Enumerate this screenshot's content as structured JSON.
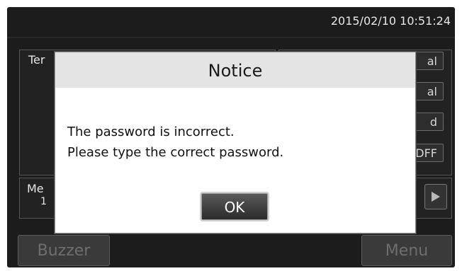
{
  "header": {
    "datetime": "2015/02/10  10:51:24"
  },
  "background": {
    "left_panel_label": "Ter",
    "right_buttons": [
      "al",
      "al",
      "d",
      "DFF"
    ],
    "mid_panel_label_1": "Me",
    "mid_panel_label_2": "1"
  },
  "footer": {
    "buzzer_label": "Buzzer",
    "menu_label": "Menu"
  },
  "dialog": {
    "title": "Notice",
    "message_line1": "The password is incorrect.",
    "message_line2": "Please type the correct password.",
    "ok_label": "OK"
  }
}
